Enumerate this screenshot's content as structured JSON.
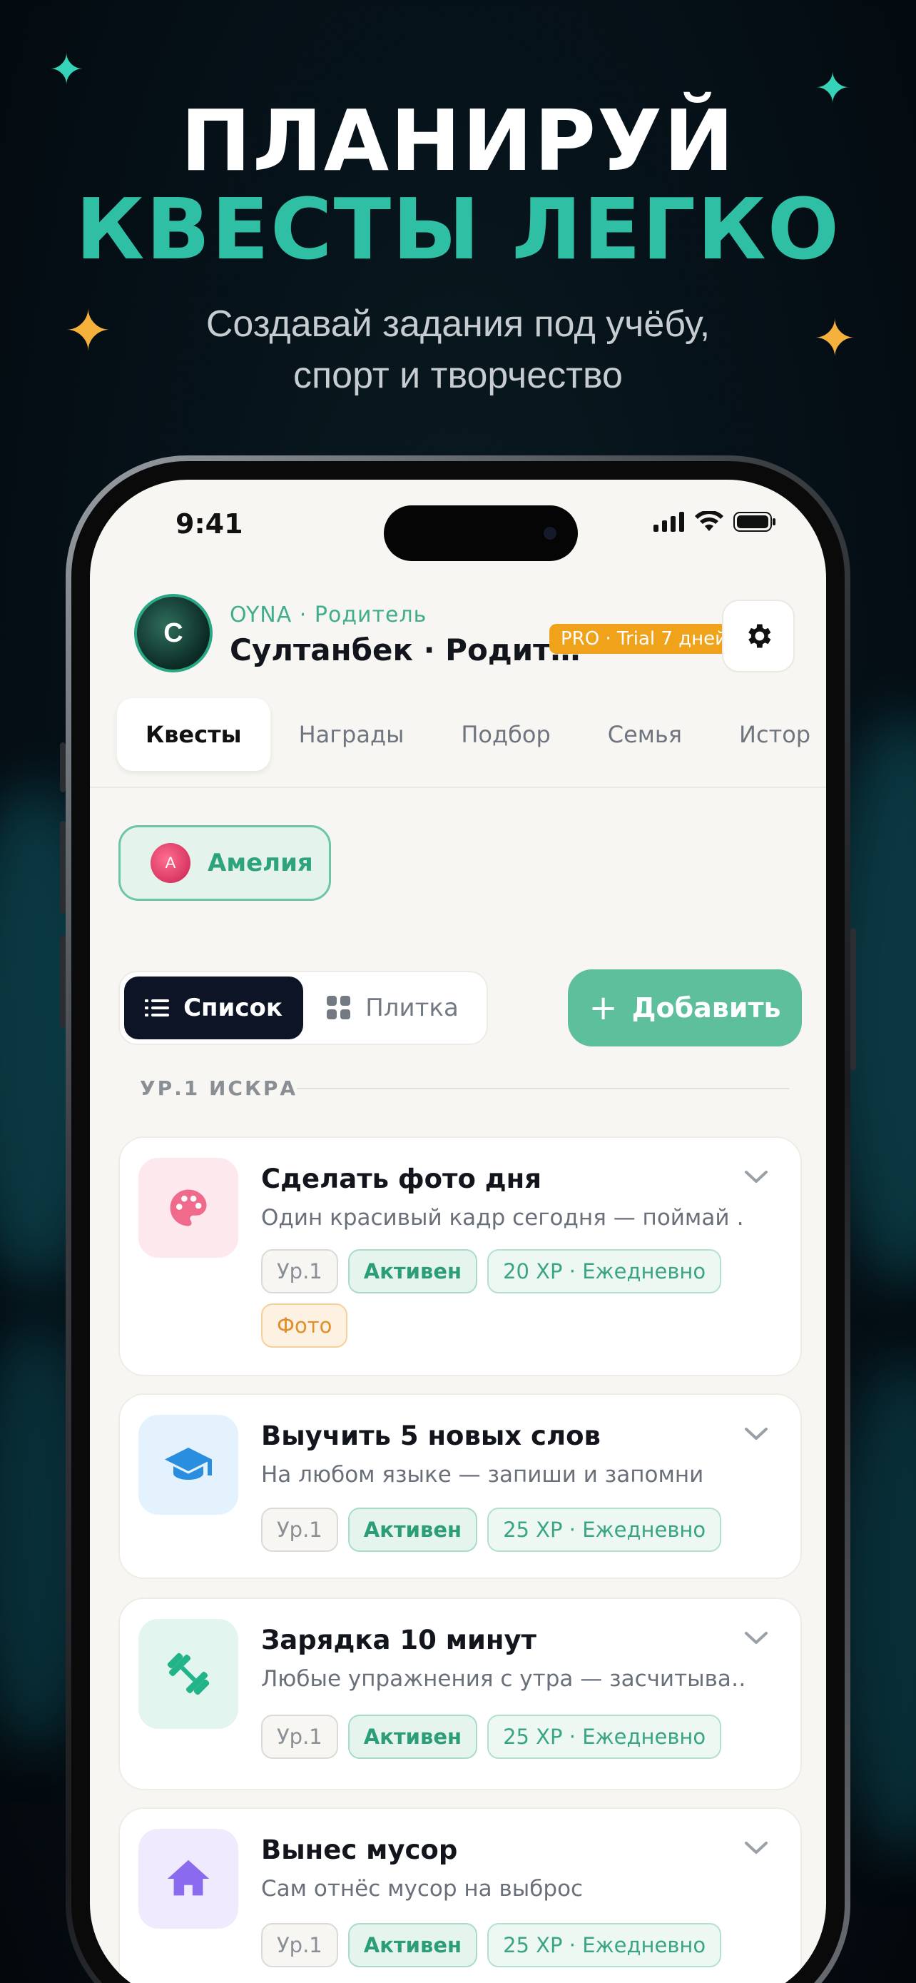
{
  "hero": {
    "line1": "ПЛАНИРУЙ",
    "line2": "КВЕСТЫ ЛЕГКО",
    "subtitle_1": "Создавай задания под учёбу,",
    "subtitle_2": "спорт и творчество"
  },
  "status_bar": {
    "time": "9:41"
  },
  "profile": {
    "avatar_letter": "С",
    "role": "OYNA · Родитель",
    "name": "Султанбек · Родит…",
    "badge": "PRO · Trial 7 дней"
  },
  "tabs": [
    "Квесты",
    "Награды",
    "Подбор",
    "Семья",
    "Истор"
  ],
  "child": {
    "avatar_letter": "А",
    "name": "Амелия"
  },
  "view_toggle": {
    "list": "Список",
    "grid": "Плитка"
  },
  "add_button": {
    "label": "Добавить",
    "icon": "+"
  },
  "level_section": "УР.1 ИСКРА",
  "quests": [
    {
      "title": "Сделать фото дня",
      "description": "Один красивый кадр сегодня — поймай …",
      "icon": "palette-icon",
      "icon_bg": "#fde8ee",
      "icon_color": "#f06a8c",
      "level": "Ур.1",
      "status": "Активен",
      "xp": "20 XP · Ежедневно",
      "tag": "Фото"
    },
    {
      "title": "Выучить 5 новых слов",
      "description": "На любом языке — запиши и запомни",
      "icon": "graduation-cap-icon",
      "icon_bg": "#e3f2fc",
      "icon_color": "#2a8ee0",
      "level": "Ур.1",
      "status": "Активен",
      "xp": "25 XP · Ежедневно"
    },
    {
      "title": "Зарядка 10 минут",
      "description": "Любые упражнения с утра — засчитыва…",
      "icon": "dumbbell-icon",
      "icon_bg": "#e2f5ee",
      "icon_color": "#22b488",
      "level": "Ур.1",
      "status": "Активен",
      "xp": "25 XP · Ежедневно"
    },
    {
      "title": "Вынес мусор",
      "description": "Сам отнёс мусор на выброс",
      "icon": "house-icon",
      "icon_bg": "#efeafd",
      "icon_color": "#8a6bf0",
      "level": "Ур.1",
      "status": "Активен",
      "xp": "25 XP · Ежедневно"
    }
  ],
  "colors": {
    "accent_green": "#5dbf9c",
    "hero_teal": "#2fbfa4",
    "pro_orange": "#f0a21a",
    "dark_toggle": "#0c1426"
  }
}
